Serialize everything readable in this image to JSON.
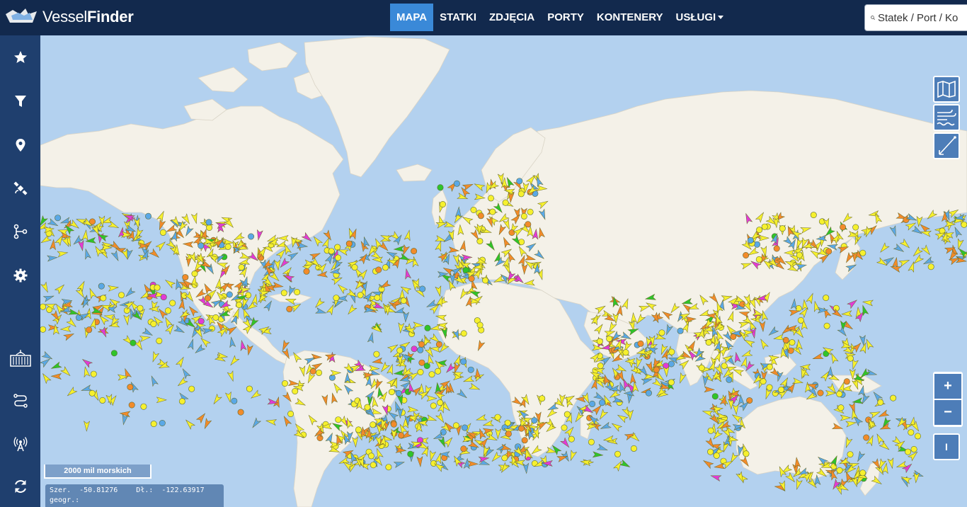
{
  "app": {
    "logo_text_light": "Vessel",
    "logo_text_bold": "Finder",
    "brand_color": "#12294d",
    "accent_color": "#3a89d8"
  },
  "nav": {
    "items": [
      {
        "label": "MAPA",
        "active": true
      },
      {
        "label": "STATKI",
        "active": false
      },
      {
        "label": "ZDJĘCIA",
        "active": false
      },
      {
        "label": "PORTY",
        "active": false
      },
      {
        "label": "KONTENERY",
        "active": false
      },
      {
        "label": "USŁUGI",
        "active": false,
        "dropdown": true
      }
    ]
  },
  "search": {
    "placeholder": "Statek / Port / Ko",
    "icon": "search-icon"
  },
  "sidebar": {
    "icons": [
      "star-icon",
      "filter-icon",
      "location-pin-icon",
      "satellite-icon",
      "route-icon",
      "gear-icon",
      "container-icon",
      "track-icon",
      "antenna-icon",
      "refresh-icon"
    ]
  },
  "map_tools": {
    "icons": [
      "map-layers-icon",
      "weather-icon",
      "measure-icon"
    ],
    "zoom_in": "+",
    "zoom_out": "−",
    "info": "I"
  },
  "scale": {
    "label": "2000 mil morskich"
  },
  "coords": {
    "lat_label": "Szer.",
    "lat_value": "-50.81276",
    "lon_label": "Dł.:",
    "lon_value": "-122.63917",
    "unit_label": "geogr.:"
  },
  "map_colors": {
    "water": "#b3d1ef",
    "land": "#f4f1e8",
    "cargo": "#f6f02e",
    "tanker": "#f28b2a",
    "passenger": "#5aa8e6",
    "special": "#e23ad6",
    "fishing": "#2fc42a"
  }
}
